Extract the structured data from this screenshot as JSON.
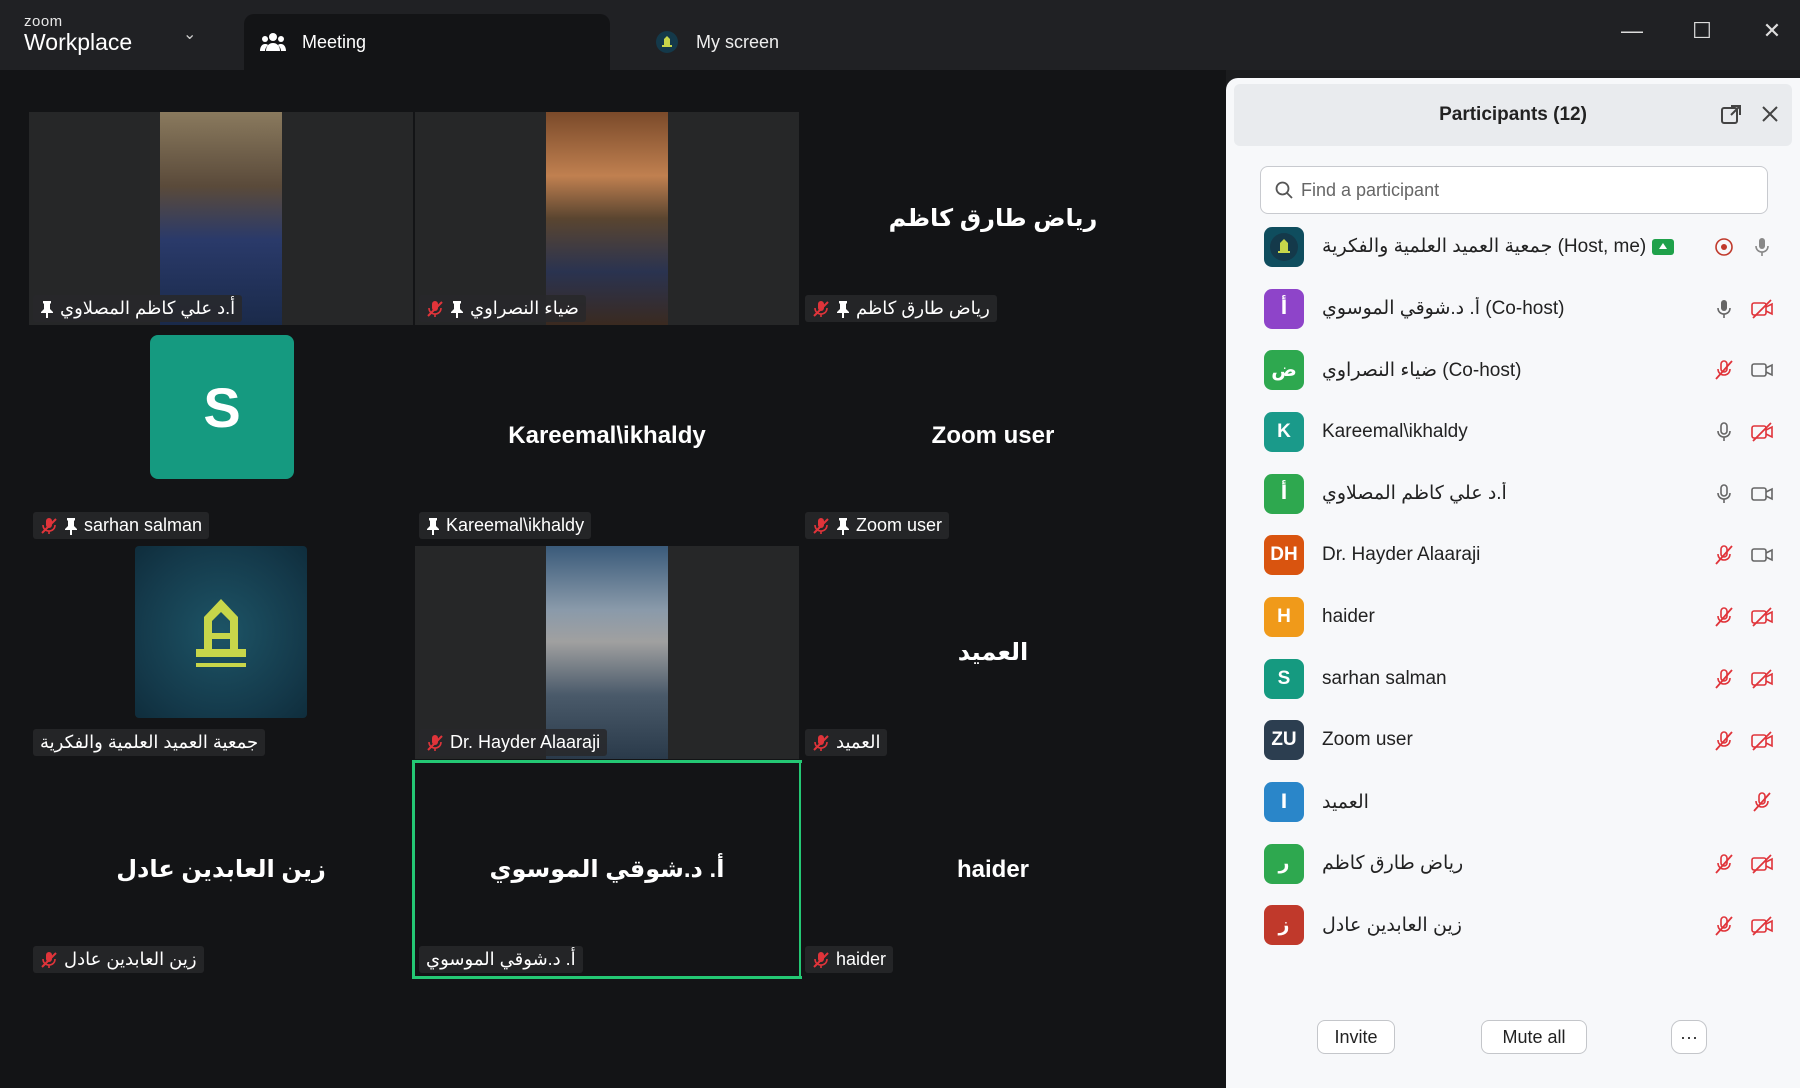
{
  "app": {
    "brand_small": "zoom",
    "brand_large": "Workplace"
  },
  "tabs": [
    {
      "label": "Meeting",
      "icon": "participants-icon",
      "active": true
    },
    {
      "label": "My screen",
      "icon": "app-logo-icon",
      "active": false
    }
  ],
  "window_controls": {
    "minimize": "—",
    "maximize": "☐",
    "close": "✕"
  },
  "gallery": [
    {
      "name": "أ.د علي كاظم المصلاوي",
      "kind": "video",
      "muted": false,
      "pinned": true
    },
    {
      "name": "ضياء النصراوي",
      "kind": "video",
      "muted": true,
      "pinned": true
    },
    {
      "name": "رياض طارق كاظم",
      "center_name": "رياض طارق كاظم",
      "kind": "name",
      "muted": true,
      "pinned": true
    },
    {
      "name": "sarhan salman",
      "avatar_letter": "S",
      "kind": "avatar",
      "muted": true,
      "pinned": true
    },
    {
      "name": "Kareemal\\ikhaldy",
      "center_name": "Kareemal\\ikhaldy",
      "kind": "name",
      "muted": false,
      "pinned": true
    },
    {
      "name": "Zoom user",
      "center_name": "Zoom user",
      "kind": "name",
      "muted": true,
      "pinned": true
    },
    {
      "name": "جمعية العميد العلمية والفكرية",
      "kind": "logo",
      "muted": false,
      "pinned": false
    },
    {
      "name": "Dr. Hayder Alaaraji",
      "kind": "video",
      "muted": true,
      "pinned": false
    },
    {
      "name": "العميد",
      "center_name": "العميد",
      "kind": "name",
      "muted": true,
      "pinned": false
    },
    {
      "name": "زين العابدين عادل",
      "center_name": "زين العابدين عادل",
      "kind": "name",
      "muted": true,
      "pinned": false
    },
    {
      "name": "أ. د.شوقي الموسوي",
      "center_name": "أ. د.شوقي الموسوي",
      "kind": "name",
      "muted": false,
      "pinned": false,
      "active_speaker": true
    },
    {
      "name": "haider",
      "center_name": "haider",
      "kind": "name",
      "muted": true,
      "pinned": false
    }
  ],
  "participants_panel": {
    "title": "Participants (12)",
    "search_placeholder": "Find a participant",
    "participants": [
      {
        "initials": "",
        "color": "#0f4d5e",
        "name": "جمعية العميد العلمية والفكرية (Host, me)",
        "icons": [
          "share-badge",
          "record-icon",
          "mic-icon"
        ]
      },
      {
        "initials": "أ",
        "color": "#8e44c9",
        "name": "أ. د.شوقي الموسوي (Co-host)",
        "icons": [
          "mic-icon",
          "video-off-icon"
        ]
      },
      {
        "initials": "ض",
        "color": "#2ea84f",
        "name": "ضياء النصراوي (Co-host)",
        "icons": [
          "mic-off-icon",
          "video-icon"
        ]
      },
      {
        "initials": "K",
        "color": "#1a9a8a",
        "name": "Kareemal\\ikhaldy",
        "icons": [
          "mic-icon",
          "video-off-icon"
        ]
      },
      {
        "initials": "أ",
        "color": "#2ea84f",
        "name": "أ.د علي كاظم المصلاوي",
        "icons": [
          "mic-icon",
          "video-icon"
        ]
      },
      {
        "initials": "DH",
        "color": "#d9540f",
        "name": "Dr. Hayder Alaaraji",
        "icons": [
          "mic-off-icon",
          "video-icon"
        ]
      },
      {
        "initials": "H",
        "color": "#f09a1a",
        "name": "haider",
        "icons": [
          "mic-off-icon",
          "video-off-icon"
        ]
      },
      {
        "initials": "S",
        "color": "#159a80",
        "name": "sarhan salman",
        "icons": [
          "mic-off-icon",
          "video-off-icon"
        ]
      },
      {
        "initials": "ZU",
        "color": "#2c3e50",
        "name": "Zoom user",
        "icons": [
          "mic-off-icon",
          "video-off-icon"
        ]
      },
      {
        "initials": "ا",
        "color": "#2a86c9",
        "name": "العميد",
        "icons": [
          "mic-off-icon"
        ]
      },
      {
        "initials": "ر",
        "color": "#2ea84f",
        "name": "رياض طارق كاظم",
        "icons": [
          "mic-off-icon",
          "video-off-icon"
        ]
      },
      {
        "initials": "ز",
        "color": "#c0392b",
        "name": "زين العابدين عادل",
        "icons": [
          "mic-off-icon",
          "video-off-icon"
        ]
      }
    ],
    "invite_label": "Invite",
    "mute_all_label": "Mute all",
    "more_label": "···"
  }
}
